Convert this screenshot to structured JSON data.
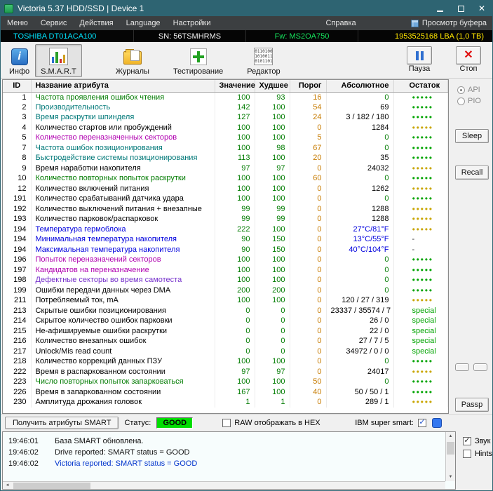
{
  "window": {
    "title": "Victoria 5.37 HDD/SSD | Device 1"
  },
  "menu": {
    "items": [
      "Меню",
      "Сервис",
      "Действия",
      "Language",
      "Настройки",
      "Справка"
    ],
    "buffer_view": "Просмотр буфера"
  },
  "device_bar": {
    "model": "TOSHIBA DT01ACA100",
    "serial": "SN: 56TSMHRMS",
    "firmware": "Fw: MS2OA750",
    "capacity": "1953525168 LBA (1,0 TB)"
  },
  "toolbar": {
    "buttons": [
      {
        "label": "Инфо"
      },
      {
        "label": "S.M.A.R.T"
      },
      {
        "label": "Журналы"
      },
      {
        "label": "Тестирование"
      },
      {
        "label": "Редактор"
      }
    ],
    "pause_label": "Пауза",
    "stop_label": "Стоп"
  },
  "colors": {
    "name": {
      "green": "#007b00",
      "teal": "#007878",
      "black": "#000000",
      "magenta": "#b000b0",
      "violet": "#7733cc",
      "blue": "#0000dd"
    },
    "value": "#007b00",
    "threshold": "#c77b00",
    "abs": {
      "black": "#000000",
      "green": "#007b00",
      "blue": "#0000dd"
    }
  },
  "table": {
    "headers": [
      "ID",
      "Название атрибута",
      "Значение",
      "Худшее",
      "Порог",
      "Абсолютное",
      "Остаток"
    ],
    "health_glyphs": {
      "g": "●●●●●",
      "y": "●●●●●",
      "s": "special",
      "d": "-"
    },
    "rows": [
      {
        "id": "1",
        "name": "Частота проявления ошибок чтения",
        "nc": "green",
        "val": "100",
        "worst": "93",
        "thr": "16",
        "abs": "0",
        "ac": "green",
        "h": "g"
      },
      {
        "id": "2",
        "name": "Производительность",
        "nc": "teal",
        "val": "142",
        "worst": "100",
        "thr": "54",
        "abs": "69",
        "ac": "black",
        "h": "g"
      },
      {
        "id": "3",
        "name": "Время раскрутки шпинделя",
        "nc": "teal",
        "val": "127",
        "worst": "100",
        "thr": "24",
        "abs": "3 / 182 / 180",
        "ac": "black",
        "h": "g"
      },
      {
        "id": "4",
        "name": "Количество стартов или пробуждений",
        "nc": "black",
        "val": "100",
        "worst": "100",
        "thr": "0",
        "abs": "1284",
        "ac": "black",
        "h": "y"
      },
      {
        "id": "5",
        "name": "Количество переназначенных секторов",
        "nc": "magenta",
        "val": "100",
        "worst": "100",
        "thr": "5",
        "abs": "0",
        "ac": "green",
        "h": "g"
      },
      {
        "id": "7",
        "name": "Частота ошибок позиционирования",
        "nc": "teal",
        "val": "100",
        "worst": "98",
        "thr": "67",
        "abs": "0",
        "ac": "green",
        "h": "g"
      },
      {
        "id": "8",
        "name": "Быстродействие системы позиционирования",
        "nc": "teal",
        "val": "113",
        "worst": "100",
        "thr": "20",
        "abs": "35",
        "ac": "black",
        "h": "g"
      },
      {
        "id": "9",
        "name": "Время наработки накопителя",
        "nc": "black",
        "val": "97",
        "worst": "97",
        "thr": "0",
        "abs": "24032",
        "ac": "black",
        "h": "y"
      },
      {
        "id": "10",
        "name": "Количество повторных попыток раскрутки",
        "nc": "green",
        "val": "100",
        "worst": "100",
        "thr": "60",
        "abs": "0",
        "ac": "green",
        "h": "g"
      },
      {
        "id": "12",
        "name": "Количество включений питания",
        "nc": "black",
        "val": "100",
        "worst": "100",
        "thr": "0",
        "abs": "1262",
        "ac": "black",
        "h": "y"
      },
      {
        "id": "191",
        "name": "Количество срабатываний датчика удара",
        "nc": "black",
        "val": "100",
        "worst": "100",
        "thr": "0",
        "abs": "0",
        "ac": "green",
        "h": "g"
      },
      {
        "id": "192",
        "name": "Количество выключений питания + внезапные",
        "nc": "black",
        "val": "99",
        "worst": "99",
        "thr": "0",
        "abs": "1288",
        "ac": "black",
        "h": "y"
      },
      {
        "id": "193",
        "name": "Количество парковок/распарковок",
        "nc": "black",
        "val": "99",
        "worst": "99",
        "thr": "0",
        "abs": "1288",
        "ac": "black",
        "h": "y"
      },
      {
        "id": "194",
        "name": "Температура гермоблока",
        "nc": "blue",
        "val": "222",
        "worst": "100",
        "thr": "0",
        "abs": "27°C/81°F",
        "ac": "blue",
        "h": "y"
      },
      {
        "id": "194",
        "name": "Минимальная температура накопителя",
        "nc": "blue",
        "val": "90",
        "worst": "150",
        "thr": "0",
        "abs": "13°C/55°F",
        "ac": "blue",
        "h": "d"
      },
      {
        "id": "194",
        "name": "Максимальная температура накопителя",
        "nc": "blue",
        "val": "90",
        "worst": "150",
        "thr": "0",
        "abs": "40°C/104°F",
        "ac": "blue",
        "h": "d"
      },
      {
        "id": "196",
        "name": "Попыток переназначений секторов",
        "nc": "magenta",
        "val": "100",
        "worst": "100",
        "thr": "0",
        "abs": "0",
        "ac": "green",
        "h": "g"
      },
      {
        "id": "197",
        "name": "Кандидатов на переназначение",
        "nc": "magenta",
        "val": "100",
        "worst": "100",
        "thr": "0",
        "abs": "0",
        "ac": "green",
        "h": "g"
      },
      {
        "id": "198",
        "name": "Дефектные секторы во время самотеста",
        "nc": "violet",
        "val": "100",
        "worst": "100",
        "thr": "0",
        "abs": "0",
        "ac": "green",
        "h": "g"
      },
      {
        "id": "199",
        "name": "Ошибки передачи данных через DMA",
        "nc": "black",
        "val": "200",
        "worst": "200",
        "thr": "0",
        "abs": "0",
        "ac": "green",
        "h": "g"
      },
      {
        "id": "211",
        "name": "Потребляемый ток, mA",
        "nc": "black",
        "val": "100",
        "worst": "100",
        "thr": "0",
        "abs": "120 / 27 / 319",
        "ac": "black",
        "h": "y"
      },
      {
        "id": "213",
        "name": "Скрытые ошибки позиционирования",
        "nc": "black",
        "val": "0",
        "worst": "0",
        "thr": "0",
        "abs": "23337 / 35574 / 7",
        "ac": "black",
        "h": "s"
      },
      {
        "id": "214",
        "name": "Скрытое количество ошибок парковки",
        "nc": "black",
        "val": "0",
        "worst": "0",
        "thr": "0",
        "abs": "26 / 0",
        "ac": "black",
        "h": "s"
      },
      {
        "id": "215",
        "name": "Не-афишируемые ошибки раскрутки",
        "nc": "black",
        "val": "0",
        "worst": "0",
        "thr": "0",
        "abs": "22 / 0",
        "ac": "black",
        "h": "s"
      },
      {
        "id": "216",
        "name": "Количество внезапных ошибок",
        "nc": "black",
        "val": "0",
        "worst": "0",
        "thr": "0",
        "abs": "27 / 7 / 5",
        "ac": "black",
        "h": "s"
      },
      {
        "id": "217",
        "name": "Unlock/Mis read count",
        "nc": "black",
        "val": "0",
        "worst": "0",
        "thr": "0",
        "abs": "34972 / 0 / 0",
        "ac": "black",
        "h": "s"
      },
      {
        "id": "218",
        "name": "Количество коррекций данных ПЗУ",
        "nc": "black",
        "val": "100",
        "worst": "100",
        "thr": "0",
        "abs": "0",
        "ac": "green",
        "h": "g"
      },
      {
        "id": "222",
        "name": "Время в распаркованном состоянии",
        "nc": "black",
        "val": "97",
        "worst": "97",
        "thr": "0",
        "abs": "24017",
        "ac": "black",
        "h": "y"
      },
      {
        "id": "223",
        "name": "Число повторных попыток запарковаться",
        "nc": "green",
        "val": "100",
        "worst": "100",
        "thr": "50",
        "abs": "0",
        "ac": "green",
        "h": "g"
      },
      {
        "id": "226",
        "name": "Время в запаркованном состоянии",
        "nc": "black",
        "val": "167",
        "worst": "100",
        "thr": "40",
        "abs": "50 / 50 / 1",
        "ac": "black",
        "h": "g"
      },
      {
        "id": "230",
        "name": "Амплитуда дрожания головок",
        "nc": "black",
        "val": "1",
        "worst": "1",
        "thr": "0",
        "abs": "289 / 1",
        "ac": "black",
        "h": "y"
      }
    ]
  },
  "sidebar": {
    "api_label": "API",
    "pio_label": "PIO",
    "sleep_label": "Sleep",
    "recall_label": "Recall",
    "passp_label": "Passp"
  },
  "status_bar": {
    "get_smart_label": "Получить атрибуты SMART",
    "status_label": "Статус:",
    "status_value": "GOOD",
    "raw_hex_label": "RAW отображать в HEX",
    "ibm_label": "IBM super smart:"
  },
  "log": {
    "entries": [
      {
        "time": "19:46:01",
        "text": "База SMART обновлена.",
        "color": "black"
      },
      {
        "time": "19:46:02",
        "text": "Drive reported: SMART status = GOOD",
        "color": "black"
      },
      {
        "time": "19:46:02",
        "text": "Victoria reported: SMART status = GOOD",
        "color": "blue"
      }
    ]
  },
  "bottom_right": {
    "sound_label": "Звук",
    "hints_label": "Hints"
  },
  "icons": {
    "close_glyph": "✕",
    "stop_glyph": "✕",
    "info_glyph": "i",
    "check": "✓",
    "up_arrow": "▲",
    "down_arrow": "▼",
    "left_arrow": "◄",
    "right_arrow": "►",
    "binary_row1": "0110100",
    "binary_row2": "1010011",
    "binary_row3": "0101101"
  }
}
